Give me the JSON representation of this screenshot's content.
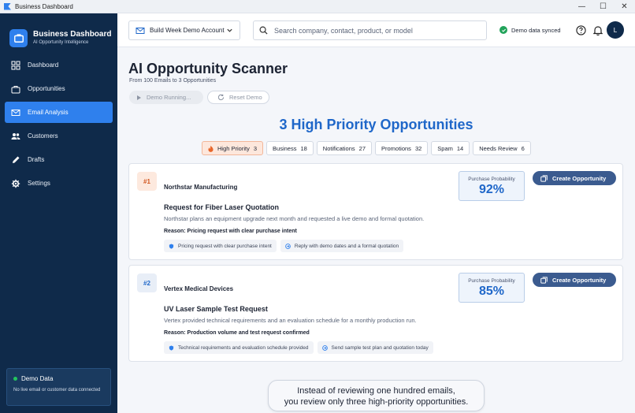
{
  "window": {
    "title": "Business Dashboard",
    "controls": [
      "—",
      "☐",
      "✕"
    ]
  },
  "brand": {
    "title": "Business Dashboard",
    "subtitle": "AI Opportunity Intelligence"
  },
  "sidebar": {
    "items": [
      {
        "label": "Dashboard",
        "icon": "dashboard-icon",
        "active": false
      },
      {
        "label": "Opportunities",
        "icon": "briefcase-icon",
        "active": false
      },
      {
        "label": "Email Analysis",
        "icon": "mail-icon",
        "active": true
      },
      {
        "label": "Customers",
        "icon": "people-icon",
        "active": false
      },
      {
        "label": "Drafts",
        "icon": "pencil-icon",
        "active": false
      },
      {
        "label": "Settings",
        "icon": "gear-icon",
        "active": false
      }
    ],
    "demo": {
      "title": "Demo Data",
      "description": "No live email or customer data connected",
      "status_color": "#22c55e"
    }
  },
  "topbar": {
    "account": "Build Week Demo Account",
    "search_placeholder": "Search company, contact, product, or model",
    "sync_status": "Demo data synced",
    "avatar_initial": "L"
  },
  "main": {
    "title": "AI Opportunity Scanner",
    "subtitle": "From 100 Emails to 3 Opportunities",
    "run_button": "Demo Running...",
    "reset_button": "Reset Demo",
    "headline": "3 High Priority Opportunities",
    "filters": [
      {
        "label": "High Priority",
        "count": "3",
        "active": true
      },
      {
        "label": "Business",
        "count": "18",
        "active": false
      },
      {
        "label": "Notifications",
        "count": "27",
        "active": false
      },
      {
        "label": "Promotions",
        "count": "32",
        "active": false
      },
      {
        "label": "Spam",
        "count": "14",
        "active": false
      },
      {
        "label": "Needs Review",
        "count": "6",
        "active": false
      }
    ],
    "opportunities": [
      {
        "rank": "#1",
        "company": "Northstar Manufacturing",
        "subject": "Request for Fiber Laser Quotation",
        "summary": "Northstar plans an equipment upgrade next month and requested a live demo and formal quotation.",
        "reason": "Reason: Pricing request with clear purchase intent",
        "tags": [
          "Pricing request with clear purchase intent",
          "Reply with demo dates and a formal quotation"
        ],
        "probability_label": "Purchase Probability",
        "probability": "92%",
        "action": "Create Opportunity"
      },
      {
        "rank": "#2",
        "company": "Vertex Medical Devices",
        "subject": "UV Laser Sample Test Request",
        "summary": "Vertex provided technical requirements and an evaluation schedule for a monthly production run.",
        "reason": "Reason: Production volume and test request confirmed",
        "tags": [
          "Technical requirements and evaluation schedule provided",
          "Send sample test plan and quotation today"
        ],
        "probability_label": "Purchase Probability",
        "probability": "85%",
        "action": "Create Opportunity"
      }
    ],
    "callout": {
      "line1": "Instead of reviewing one hundred emails,",
      "line2": "you review only three high-priority opportunities."
    }
  },
  "colors": {
    "sidebar": "#0f2a4a",
    "accent": "#2f80ed",
    "headline": "#1f67c9",
    "primary_button": "#3b5b8f"
  }
}
